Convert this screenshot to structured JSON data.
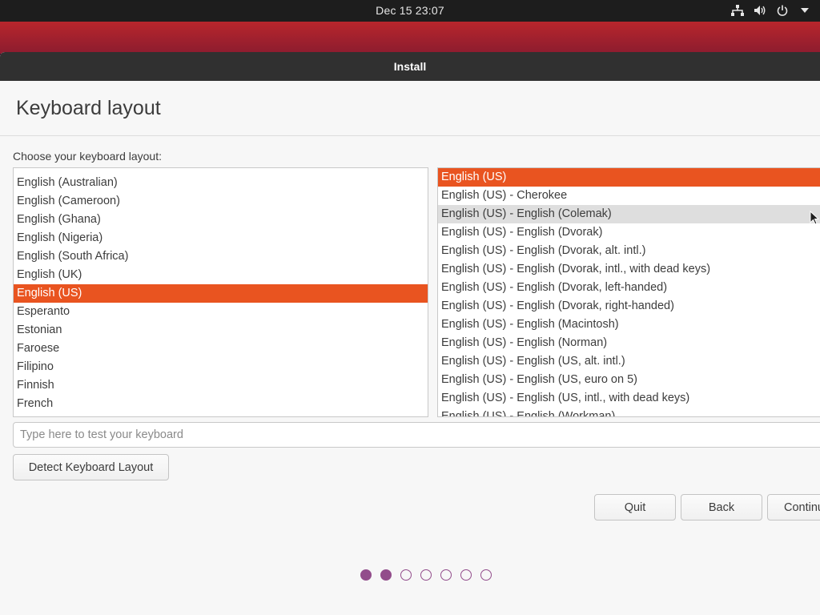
{
  "topbar": {
    "clock": "Dec 15  23:07",
    "icons": [
      "network-icon",
      "volume-icon",
      "power-icon",
      "menu-arrow-icon"
    ]
  },
  "window": {
    "title": "Install"
  },
  "page": {
    "heading": "Keyboard layout",
    "choose_label": "Choose your keyboard layout:"
  },
  "layouts": [
    "English (Australian)",
    "English (Cameroon)",
    "English (Ghana)",
    "English (Nigeria)",
    "English (South Africa)",
    "English (UK)",
    "English (US)",
    "Esperanto",
    "Estonian",
    "Faroese",
    "Filipino",
    "Finnish",
    "French"
  ],
  "layouts_selected": "English (US)",
  "variants": [
    "English (US)",
    "English (US) - Cherokee",
    "English (US) - English (Colemak)",
    "English (US) - English (Dvorak)",
    "English (US) - English (Dvorak, alt. intl.)",
    "English (US) - English (Dvorak, intl., with dead keys)",
    "English (US) - English (Dvorak, left-handed)",
    "English (US) - English (Dvorak, right-handed)",
    "English (US) - English (Macintosh)",
    "English (US) - English (Norman)",
    "English (US) - English (US, alt. intl.)",
    "English (US) - English (US, euro on 5)",
    "English (US) - English (US, intl., with dead keys)",
    "English (US) - English (Workman)"
  ],
  "variants_selected": "English (US)",
  "variants_hovered": "English (US) - English (Colemak)",
  "test_input": {
    "placeholder": "Type here to test your keyboard",
    "value": ""
  },
  "buttons": {
    "detect": "Detect Keyboard Layout",
    "quit": "Quit",
    "back": "Back",
    "continue": "Continue"
  },
  "progress": {
    "total_steps": 7,
    "completed_steps": 2
  },
  "colors": {
    "accent": "#e95420",
    "progress": "#924d8b",
    "titlebar": "#303030"
  }
}
